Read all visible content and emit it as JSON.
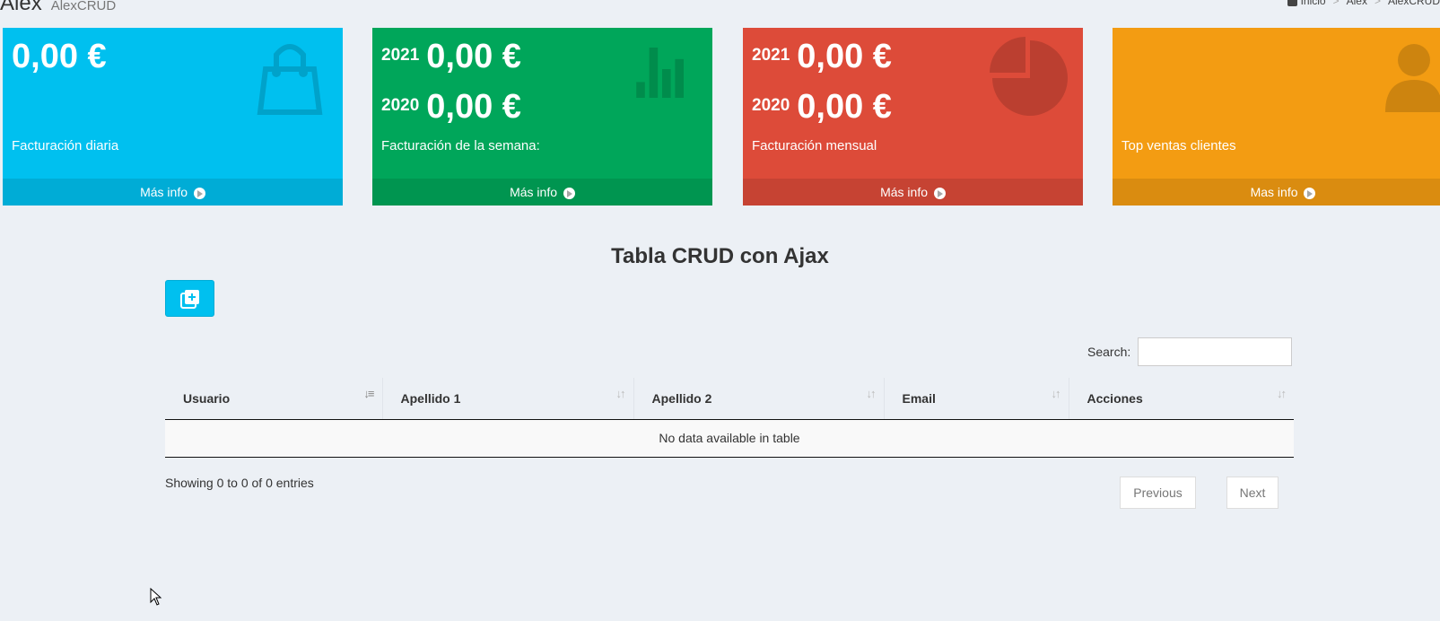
{
  "header": {
    "title": "Alex",
    "subtitle": "AlexCRUD"
  },
  "breadcrumb": {
    "items": [
      "Inicio",
      "Alex",
      "AlexCRUD"
    ],
    "separator": ">"
  },
  "boxes": [
    {
      "amount": "0,00 €",
      "label": "Facturación diaria",
      "footer": "Más info",
      "color": "#00c0ef",
      "icon": "shopping-bag-icon"
    },
    {
      "year1": "2021",
      "amount1": "0,00 €",
      "year2": "2020",
      "amount2": "0,00 €",
      "label": "Facturación de la semana:",
      "footer": "Más info",
      "color": "#00a65a",
      "icon": "bar-chart-icon"
    },
    {
      "year1": "2021",
      "amount1": "0,00 €",
      "year2": "2020",
      "amount2": "0,00 €",
      "label": "Facturación mensual",
      "footer": "Más info",
      "color": "#dd4b39",
      "icon": "pie-chart-icon"
    },
    {
      "label": "Top ventas clientes",
      "footer": "Mas info",
      "color": "#f39c12",
      "icon": "user-plus-icon"
    }
  ],
  "crud": {
    "title": "Tabla CRUD con Ajax",
    "add_icon": "add-copy-icon",
    "search_label": "Search:",
    "search_value": "",
    "columns": [
      "Usuario",
      "Apellido 1",
      "Apellido 2",
      "Email",
      "Acciones"
    ],
    "empty_message": "No data available in table",
    "info": "Showing 0 to 0 of 0 entries",
    "prev_label": "Previous",
    "next_label": "Next"
  }
}
